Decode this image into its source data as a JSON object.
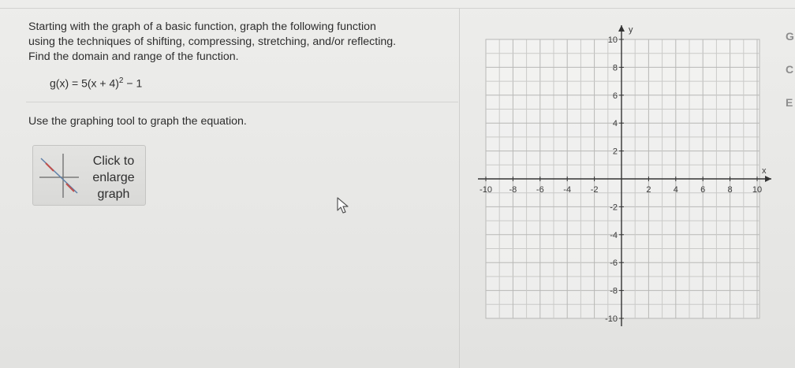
{
  "question": {
    "line1": "Starting with the graph of a basic function, graph the following function",
    "line2": "using the techniques of shifting, compressing, stretching, and/or reflecting.",
    "line3": "Find the domain and range of the function."
  },
  "equation": {
    "lhs": "g(x) = 5(x + 4)",
    "exponent": "2",
    "rhs": " − 1"
  },
  "instruction": "Use the graphing tool to graph the equation.",
  "enlarge_button": {
    "line1": "Click to",
    "line2": "enlarge",
    "line3": "graph"
  },
  "graph": {
    "x_label": "x",
    "y_label": "y",
    "x_ticks": [
      "-10",
      "-8",
      "-6",
      "-4",
      "-2",
      "2",
      "4",
      "6",
      "8",
      "10"
    ],
    "y_ticks": [
      "10",
      "8",
      "6",
      "4",
      "2",
      "-2",
      "-4",
      "-6",
      "-8",
      "-10"
    ]
  },
  "side_icons": [
    "refresh-icon",
    "undo-icon",
    "expand-icon"
  ]
}
